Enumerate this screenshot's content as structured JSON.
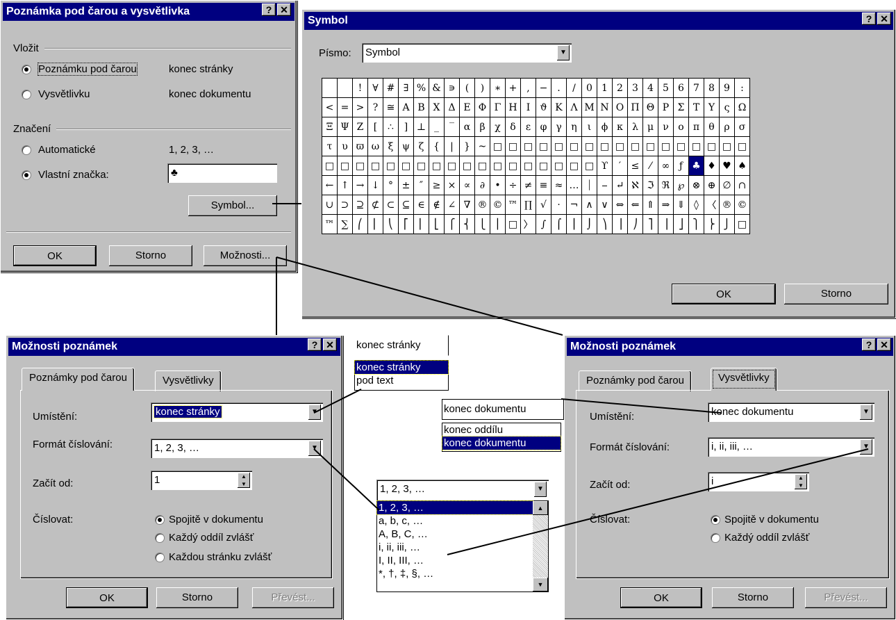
{
  "dlg_footnote": {
    "title": "Poznámka pod čarou a vysvětlivka",
    "help": "?",
    "close": "✕",
    "insert_group": "Vložit",
    "opt_footnote": "Poznámku pod čarou",
    "opt_footnote_val": "konec stránky",
    "opt_endnote": "Vysvětlivku",
    "opt_endnote_val": "konec dokumentu",
    "num_group": "Značení",
    "opt_auto": "Automatické",
    "opt_auto_val": "1, 2, 3, …",
    "opt_custom": "Vlastní značka:",
    "custom_value": "♣",
    "symbol_btn": "Symbol...",
    "ok": "OK",
    "cancel": "Storno",
    "options_btn": "Možnosti..."
  },
  "dlg_symbol": {
    "title": "Symbol",
    "help": "?",
    "close": "✕",
    "font_label": "Písmo:",
    "font_value": "Symbol",
    "ok": "OK",
    "cancel": "Storno",
    "rows": [
      [
        "",
        " ",
        "!",
        "∀",
        "#",
        "∃",
        "%",
        "&",
        "∍",
        "(",
        ")",
        "∗",
        "+",
        ",",
        "−",
        ".",
        "/",
        "0",
        "1",
        "2",
        "3",
        "4",
        "5",
        "6",
        "7",
        "8",
        "9",
        ":",
        ";"
      ],
      [
        "<",
        "=",
        ">",
        "?",
        "≅",
        "Α",
        "Β",
        "Χ",
        "Δ",
        "Ε",
        "Φ",
        "Γ",
        "Η",
        "Ι",
        "ϑ",
        "Κ",
        "Λ",
        "Μ",
        "Ν",
        "Ο",
        "Π",
        "Θ",
        "Ρ",
        "Σ",
        "Τ",
        "Υ",
        "ς",
        "Ω"
      ],
      [
        "Ξ",
        "Ψ",
        "Ζ",
        "[",
        "∴",
        "]",
        "⊥",
        "_",
        "‾",
        "α",
        "β",
        "χ",
        "δ",
        "ε",
        "φ",
        "γ",
        "η",
        "ι",
        "ϕ",
        "κ",
        "λ",
        "μ",
        "ν",
        "ο",
        "π",
        "θ",
        "ρ",
        "σ"
      ],
      [
        "τ",
        "υ",
        "ϖ",
        "ω",
        "ξ",
        "ψ",
        "ζ",
        "{",
        "|",
        "}",
        "~",
        "□",
        "□",
        "□",
        "□",
        "□",
        "□",
        "□",
        "□",
        "□",
        "□",
        "□",
        "□",
        "□",
        "□",
        "□",
        "□",
        "□"
      ],
      [
        "□",
        "□",
        "□",
        "□",
        "□",
        "□",
        "□",
        "□",
        "□",
        "□",
        "□",
        "□",
        "□",
        "□",
        "□",
        "□",
        "□",
        "□",
        "ϒ",
        "′",
        "≤",
        "⁄",
        "∞",
        "ƒ",
        "♣",
        "♦",
        "♥",
        "♠",
        "↔"
      ],
      [
        "←",
        "↑",
        "→",
        "↓",
        "°",
        "±",
        "″",
        "≥",
        "×",
        "∝",
        "∂",
        "•",
        "÷",
        "≠",
        "≡",
        "≈",
        "…",
        "⏐",
        "⎯",
        "↵",
        "ℵ",
        "ℑ",
        "ℜ",
        "℘",
        "⊗",
        "⊕",
        "∅",
        "∩"
      ],
      [
        "∪",
        "⊃",
        "⊇",
        "⊄",
        "⊂",
        "⊆",
        "∈",
        "∉",
        "∠",
        "∇",
        "®",
        "©",
        "™",
        "∏",
        "√",
        "⋅",
        "¬",
        "∧",
        "∨",
        "⇔",
        "⇐",
        "⇑",
        "⇒",
        "⇓",
        "◊",
        "〈",
        "®",
        "©"
      ],
      [
        "™",
        "∑",
        "⎛",
        "⎜",
        "⎝",
        "⎡",
        "⎢",
        "⎣",
        "⎧",
        "⎨",
        "⎩",
        "⎪",
        "□",
        "〉",
        "∫",
        "⌠",
        "⎮",
        "⌡",
        "⎞",
        "⎟",
        "⎠",
        "⎤",
        "⎥",
        "⎦",
        "⎫",
        "⎬",
        "⎭",
        "□"
      ]
    ]
  },
  "dlg_opt_left": {
    "title": "Možnosti poznámek",
    "help": "?",
    "close": "✕",
    "tab1": "Poznámky pod čarou",
    "tab2": "Vysvětlivky",
    "place_label": "Umístění:",
    "place_value": "konec stránky",
    "format_label": "Formát číslování:",
    "format_value": "1, 2, 3, …",
    "start_label": "Začít od:",
    "start_value": "1",
    "number_label": "Číslovat:",
    "r1": "Spojitě v dokumentu",
    "r2": "Každý oddíl zvlášť",
    "r3": "Každou stránku zvlášť",
    "ok": "OK",
    "cancel": "Storno",
    "convert": "Převést..."
  },
  "dlg_opt_right": {
    "title": "Možnosti poznámek",
    "help": "?",
    "close": "✕",
    "tab1": "Poznámky pod čarou",
    "tab2": "Vysvětlivky",
    "place_label": "Umístění:",
    "place_value": "konec dokumentu",
    "format_label": "Formát číslování:",
    "format_value": "i, ii, iii, …",
    "start_label": "Začít od:",
    "start_value": "i",
    "number_label": "Číslovat:",
    "r1": "Spojitě v dokumentu",
    "r2": "Každý oddíl zvlášť",
    "ok": "OK",
    "cancel": "Storno",
    "convert": "Převést..."
  },
  "popup_place1": {
    "current": "konec stránky",
    "items": [
      "konec stránky",
      "pod text"
    ]
  },
  "popup_place2": {
    "current": "konec dokumentu",
    "items": [
      "konec oddílu",
      "konec dokumentu"
    ]
  },
  "popup_format": {
    "current": "1, 2, 3, …",
    "items": [
      "1, 2, 3, …",
      "a, b, c, …",
      "A, B, C, …",
      "i, ii, iii, …",
      "I, II, III, …",
      "*, †, ‡, §, …"
    ]
  }
}
